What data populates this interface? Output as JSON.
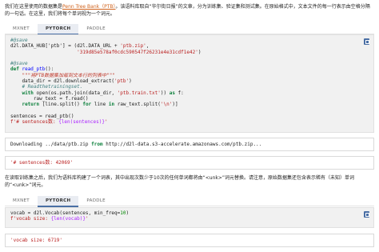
{
  "intro": {
    "pre": "我们在这里使用的数据集是",
    "link": "Penn Tree Bank（PTB）",
    "post": "。该语料库取自“华尔街日报”的文章，分为训练集、验证集和测试集。在原始格式中，文本文件的每一行表示由空格分隔的一句话。在这里，我们将每个单词视为一个词元。"
  },
  "tabs1": [
    "MXNET",
    "PYTORCH",
    "PADDLE"
  ],
  "tabs2": [
    "MXNET",
    "PYTORCH",
    "PADDLE"
  ],
  "code1": {
    "l1": "#@save",
    "l2a": "d2l.DATA_HUB['ptb'] = (d2l.DATA_URL + ",
    "l2b": "'ptb.zip'",
    "l2c": ",",
    "l3a": "                       ",
    "l3b": "'319d85e578af0cdc590547f26231e4e31cdf1e42'",
    "l3c": ")",
    "l5": "#@save",
    "l6a": "def",
    "l6b": "read_ptb",
    "l6c": "():",
    "l7": "    \"\"\"将PTB数据集加载到文本行的列表中\"\"\"",
    "l8a": "    data_dir = d2l.download_extract(",
    "l8b": "'ptb'",
    "l8c": ")",
    "l9": "    # Readthetrainingset.",
    "l10a": "    ",
    "l10b": "with",
    "l10c": " open(os.path.join(data_dir, ",
    "l10d": "'ptb.train.txt'",
    "l10e": ")) ",
    "l10f": "as",
    "l10g": " f:",
    "l11": "        raw_text = f.read()",
    "l12a": "    ",
    "l12b": "return",
    "l12c": " [line.split() ",
    "l12d": "for",
    "l12e": " line ",
    "l12f": "in",
    "l12g": " raw_text.split(",
    "l12h": "'\\n'",
    "l12i": ")]",
    "l14": "sentences = read_ptb()",
    "l15a": "f'# sentences数: ",
    "l15b": "{len(sentences)}",
    "l15c": "'"
  },
  "output1": {
    "pre": "Downloading ../data/ptb.zip ",
    "from": "from",
    "post": " http://d2l-data.s3-accelerate.amazonaws.com/ptb.zip..."
  },
  "output2": "'# sentences数: 42069'",
  "para2": "在读取训练集之后，我们为语料库构建了一个词表，其中出现次数少于10次的任何单词都将由“<unk>”词元替换。请注意，原始数据集还包含表示稀有（未知）单词的“<unk>”词元。",
  "code2": {
    "l1a": "vocab = d2l.Vocab(sentences, min_freq=",
    "l1b": "10",
    "l1c": ")",
    "l2a": "f'vocab size: ",
    "l2b": "{len(vocab)}",
    "l2c": "'"
  },
  "output3": "'vocab size: 6719'",
  "colors": {
    "link": "#d0611a",
    "tab_accent": "#4a6fa5",
    "code_bg": "#f1f1f1"
  },
  "icons": [
    "copy-icon"
  ]
}
